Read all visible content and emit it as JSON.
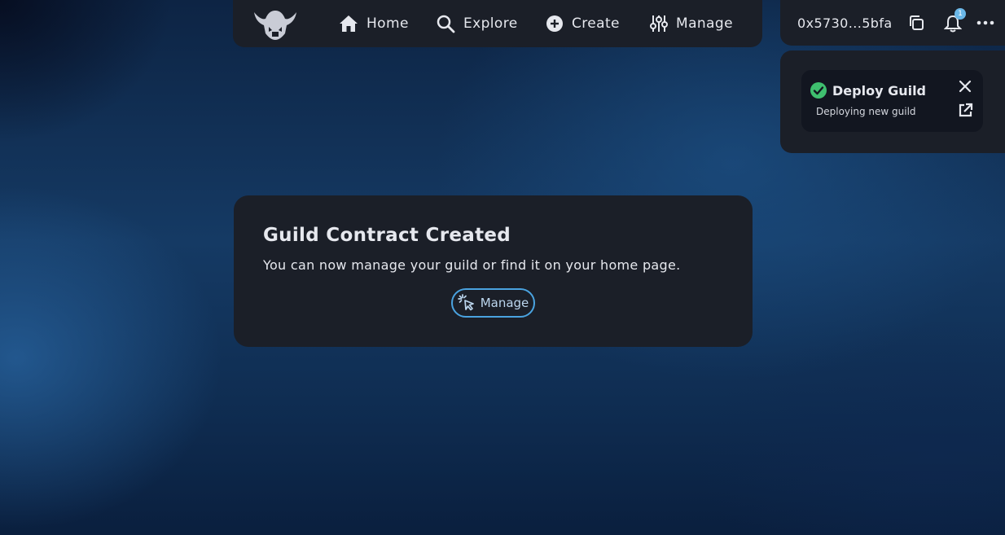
{
  "nav": {
    "logo": "guild-logo",
    "items": [
      {
        "label": "Home",
        "icon": "home-icon"
      },
      {
        "label": "Explore",
        "icon": "search-icon"
      },
      {
        "label": "Create",
        "icon": "plus-circle-icon"
      },
      {
        "label": "Manage",
        "icon": "sliders-icon"
      }
    ]
  },
  "account": {
    "address": "0x5730...5bfa",
    "notification_count": "1",
    "icons": [
      "copy-icon",
      "bell-icon",
      "more-icon"
    ]
  },
  "toast": {
    "title": "Deploy Guild",
    "message": "Deploying new guild",
    "status_color": "#3fbf6f"
  },
  "card": {
    "title": "Guild Contract Created",
    "text": "You can now manage your guild or find it on your home page.",
    "button_label": "Manage"
  },
  "colors": {
    "accent": "#4aa3e0",
    "panel": "#1b1f28",
    "success": "#3fbf6f"
  }
}
